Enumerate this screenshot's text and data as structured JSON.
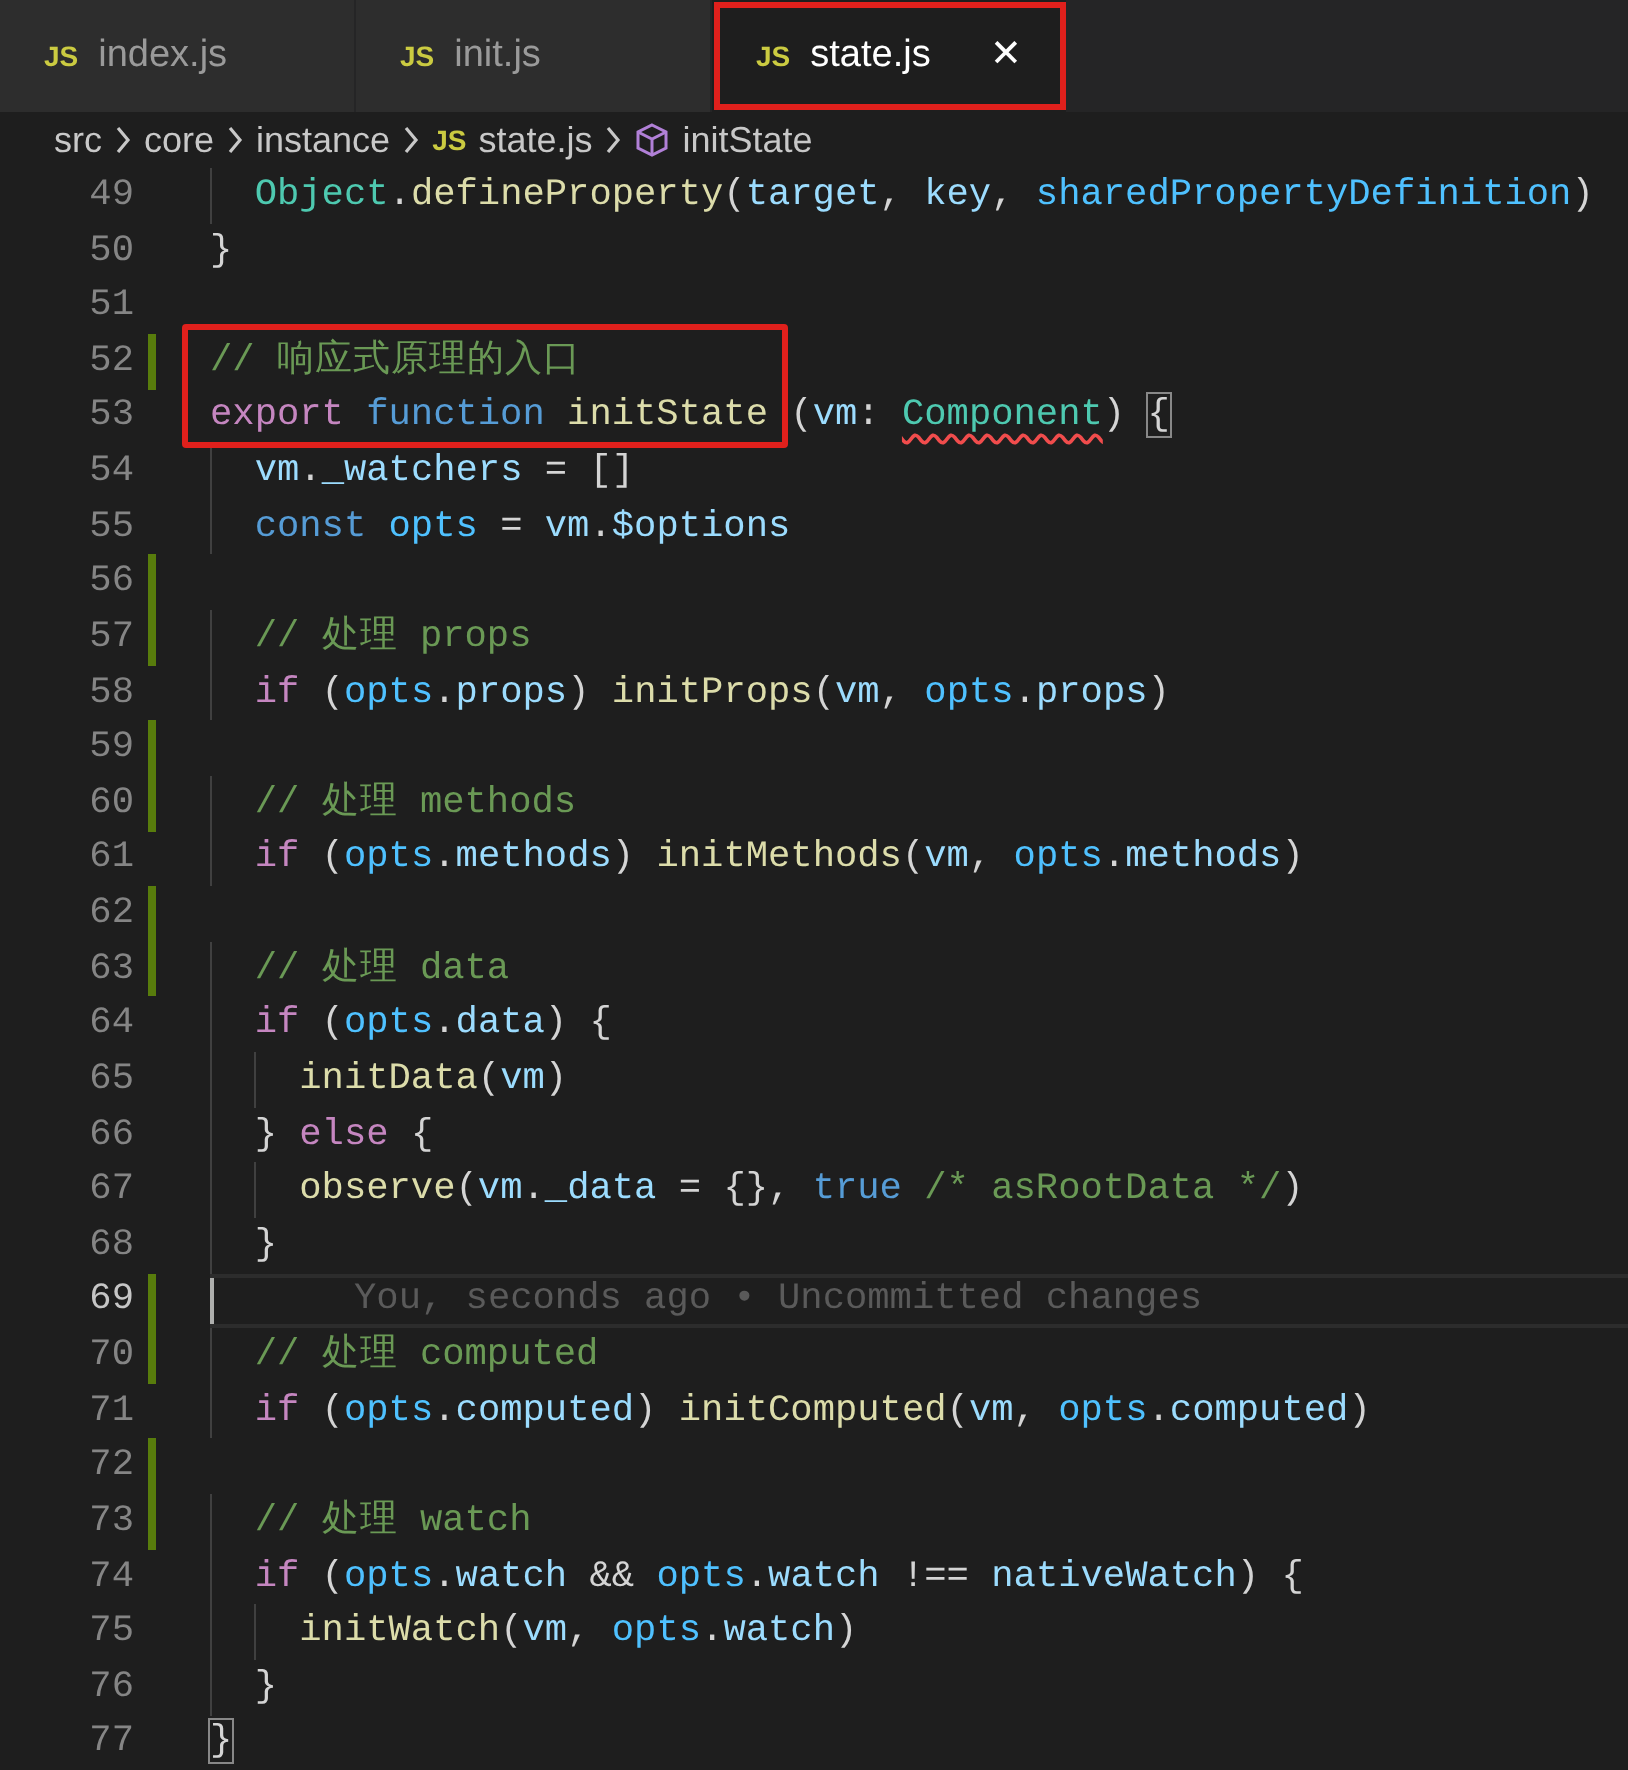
{
  "tabs": [
    {
      "icon": "JS",
      "label": "index.js",
      "selected": false,
      "outlined": false
    },
    {
      "icon": "JS",
      "label": "init.js",
      "selected": false,
      "outlined": false
    },
    {
      "icon": "JS",
      "label": "state.js",
      "selected": true,
      "outlined": true,
      "close": "✕"
    }
  ],
  "breadcrumb": [
    {
      "kind": "folder",
      "label": "src"
    },
    {
      "kind": "folder",
      "label": "core"
    },
    {
      "kind": "folder",
      "label": "instance"
    },
    {
      "kind": "file",
      "icon": "JS",
      "label": "state.js"
    },
    {
      "kind": "symbol",
      "label": "initState"
    }
  ],
  "lines": [
    {
      "number": "49",
      "modified": false,
      "tokens": [
        {
          "t": "  Object",
          "kind": "type"
        },
        {
          "t": ".",
          "kind": "punct"
        },
        {
          "t": "defineProperty",
          "kind": "func"
        },
        {
          "t": "(",
          "kind": "punct"
        },
        {
          "t": "target",
          "kind": "variable"
        },
        {
          "t": ", ",
          "kind": "punct"
        },
        {
          "t": "key",
          "kind": "variable"
        },
        {
          "t": ", ",
          "kind": "punct"
        },
        {
          "t": "sharedPropertyDefinition",
          "kind": "constant"
        },
        {
          "t": ")",
          "kind": "punct"
        }
      ]
    },
    {
      "number": "50",
      "modified": false,
      "tokens": [
        {
          "t": "}",
          "kind": "punct"
        }
      ]
    },
    {
      "number": "51",
      "modified": false
    },
    {
      "number": "52",
      "modified": true,
      "tokens": [
        {
          "t": "// 响应式原理的入口",
          "kind": "comment",
          "boxed": true
        }
      ]
    },
    {
      "number": "53",
      "modified": false,
      "tokens": [
        {
          "t": "export",
          "kind": "keyword",
          "boxed": true
        },
        {
          "t": " function",
          "kind": "storage",
          "boxed": true
        },
        {
          "t": " initState",
          "kind": "func",
          "boxed": true
        },
        {
          "t": " (",
          "kind": "punct"
        },
        {
          "t": "vm",
          "kind": "variable"
        },
        {
          "t": ": ",
          "kind": "punct"
        },
        {
          "t": "Component",
          "kind": "type",
          "error": true
        },
        {
          "t": ") ",
          "kind": "punct"
        },
        {
          "t": "{",
          "kind": "punct",
          "match": true
        }
      ]
    },
    {
      "number": "54",
      "modified": false,
      "tokens": [
        {
          "t": "  vm",
          "kind": "variable"
        },
        {
          "t": ".",
          "kind": "punct"
        },
        {
          "t": "_watchers",
          "kind": "variable"
        },
        {
          "t": " = []",
          "kind": "punct"
        }
      ]
    },
    {
      "number": "55",
      "modified": false,
      "tokens": [
        {
          "t": "  const",
          "kind": "storage"
        },
        {
          "t": " opts",
          "kind": "constant"
        },
        {
          "t": " = ",
          "kind": "punct"
        },
        {
          "t": "vm",
          "kind": "variable"
        },
        {
          "t": ".",
          "kind": "punct"
        },
        {
          "t": "$options",
          "kind": "variable"
        }
      ]
    },
    {
      "number": "56",
      "modified": true
    },
    {
      "number": "57",
      "modified": true,
      "tokens": [
        {
          "t": "  // 处理 props",
          "kind": "comment"
        }
      ]
    },
    {
      "number": "58",
      "modified": false,
      "tokens": [
        {
          "t": "  if",
          "kind": "keyword"
        },
        {
          "t": " (",
          "kind": "punct"
        },
        {
          "t": "opts",
          "kind": "constant"
        },
        {
          "t": ".",
          "kind": "punct"
        },
        {
          "t": "props",
          "kind": "variable"
        },
        {
          "t": ") ",
          "kind": "punct"
        },
        {
          "t": "initProps",
          "kind": "func"
        },
        {
          "t": "(",
          "kind": "punct"
        },
        {
          "t": "vm",
          "kind": "variable"
        },
        {
          "t": ", ",
          "kind": "punct"
        },
        {
          "t": "opts",
          "kind": "constant"
        },
        {
          "t": ".",
          "kind": "punct"
        },
        {
          "t": "props",
          "kind": "variable"
        },
        {
          "t": ")",
          "kind": "punct"
        }
      ]
    },
    {
      "number": "59",
      "modified": true
    },
    {
      "number": "60",
      "modified": true,
      "tokens": [
        {
          "t": "  // 处理 methods",
          "kind": "comment"
        }
      ]
    },
    {
      "number": "61",
      "modified": false,
      "tokens": [
        {
          "t": "  if",
          "kind": "keyword"
        },
        {
          "t": " (",
          "kind": "punct"
        },
        {
          "t": "opts",
          "kind": "constant"
        },
        {
          "t": ".",
          "kind": "punct"
        },
        {
          "t": "methods",
          "kind": "variable"
        },
        {
          "t": ") ",
          "kind": "punct"
        },
        {
          "t": "initMethods",
          "kind": "func"
        },
        {
          "t": "(",
          "kind": "punct"
        },
        {
          "t": "vm",
          "kind": "variable"
        },
        {
          "t": ", ",
          "kind": "punct"
        },
        {
          "t": "opts",
          "kind": "constant"
        },
        {
          "t": ".",
          "kind": "punct"
        },
        {
          "t": "methods",
          "kind": "variable"
        },
        {
          "t": ")",
          "kind": "punct"
        }
      ]
    },
    {
      "number": "62",
      "modified": true
    },
    {
      "number": "63",
      "modified": true,
      "tokens": [
        {
          "t": "  // 处理 data",
          "kind": "comment"
        }
      ]
    },
    {
      "number": "64",
      "modified": false,
      "tokens": [
        {
          "t": "  if",
          "kind": "keyword"
        },
        {
          "t": " (",
          "kind": "punct"
        },
        {
          "t": "opts",
          "kind": "constant"
        },
        {
          "t": ".",
          "kind": "punct"
        },
        {
          "t": "data",
          "kind": "variable"
        },
        {
          "t": ") {",
          "kind": "punct"
        }
      ]
    },
    {
      "number": "65",
      "modified": false,
      "tokens": [
        {
          "t": "    initData",
          "kind": "func"
        },
        {
          "t": "(",
          "kind": "punct"
        },
        {
          "t": "vm",
          "kind": "variable"
        },
        {
          "t": ")",
          "kind": "punct"
        }
      ]
    },
    {
      "number": "66",
      "modified": false,
      "tokens": [
        {
          "t": "  } ",
          "kind": "punct"
        },
        {
          "t": "else",
          "kind": "keyword"
        },
        {
          "t": " {",
          "kind": "punct"
        }
      ]
    },
    {
      "number": "67",
      "modified": false,
      "tokens": [
        {
          "t": "    observe",
          "kind": "func"
        },
        {
          "t": "(",
          "kind": "punct"
        },
        {
          "t": "vm",
          "kind": "variable"
        },
        {
          "t": ".",
          "kind": "punct"
        },
        {
          "t": "_data",
          "kind": "variable"
        },
        {
          "t": " = {}, ",
          "kind": "punct"
        },
        {
          "t": "true",
          "kind": "storage"
        },
        {
          "t": " /* asRootData */",
          "kind": "comment"
        },
        {
          "t": ")",
          "kind": "punct"
        }
      ]
    },
    {
      "number": "68",
      "modified": false,
      "tokens": [
        {
          "t": "  }",
          "kind": "punct"
        }
      ]
    },
    {
      "number": "69",
      "modified": true,
      "current": true,
      "blame": "You, seconds ago • Uncommitted changes"
    },
    {
      "number": "70",
      "modified": true,
      "tokens": [
        {
          "t": "  // 处理 computed",
          "kind": "comment"
        }
      ]
    },
    {
      "number": "71",
      "modified": false,
      "tokens": [
        {
          "t": "  if",
          "kind": "keyword"
        },
        {
          "t": " (",
          "kind": "punct"
        },
        {
          "t": "opts",
          "kind": "constant"
        },
        {
          "t": ".",
          "kind": "punct"
        },
        {
          "t": "computed",
          "kind": "variable"
        },
        {
          "t": ") ",
          "kind": "punct"
        },
        {
          "t": "initComputed",
          "kind": "func"
        },
        {
          "t": "(",
          "kind": "punct"
        },
        {
          "t": "vm",
          "kind": "variable"
        },
        {
          "t": ", ",
          "kind": "punct"
        },
        {
          "t": "opts",
          "kind": "constant"
        },
        {
          "t": ".",
          "kind": "punct"
        },
        {
          "t": "computed",
          "kind": "variable"
        },
        {
          "t": ")",
          "kind": "punct"
        }
      ]
    },
    {
      "number": "72",
      "modified": true
    },
    {
      "number": "73",
      "modified": true,
      "tokens": [
        {
          "t": "  // 处理 watch",
          "kind": "comment"
        }
      ]
    },
    {
      "number": "74",
      "modified": false,
      "tokens": [
        {
          "t": "  if",
          "kind": "keyword"
        },
        {
          "t": " (",
          "kind": "punct"
        },
        {
          "t": "opts",
          "kind": "constant"
        },
        {
          "t": ".",
          "kind": "punct"
        },
        {
          "t": "watch",
          "kind": "variable"
        },
        {
          "t": " && ",
          "kind": "punct"
        },
        {
          "t": "opts",
          "kind": "constant"
        },
        {
          "t": ".",
          "kind": "punct"
        },
        {
          "t": "watch",
          "kind": "variable"
        },
        {
          "t": " !== ",
          "kind": "punct"
        },
        {
          "t": "nativeWatch",
          "kind": "variable"
        },
        {
          "t": ") {",
          "kind": "punct"
        }
      ]
    },
    {
      "number": "75",
      "modified": false,
      "tokens": [
        {
          "t": "    initWatch",
          "kind": "func"
        },
        {
          "t": "(",
          "kind": "punct"
        },
        {
          "t": "vm",
          "kind": "variable"
        },
        {
          "t": ", ",
          "kind": "punct"
        },
        {
          "t": "opts",
          "kind": "constant"
        },
        {
          "t": ".",
          "kind": "punct"
        },
        {
          "t": "watch",
          "kind": "variable"
        },
        {
          "t": ")",
          "kind": "punct"
        }
      ]
    },
    {
      "number": "76",
      "modified": false,
      "tokens": [
        {
          "t": "  }",
          "kind": "punct"
        }
      ]
    },
    {
      "number": "77",
      "modified": false,
      "tokens": [
        {
          "t": "}",
          "kind": "punct",
          "match": true
        }
      ]
    }
  ]
}
